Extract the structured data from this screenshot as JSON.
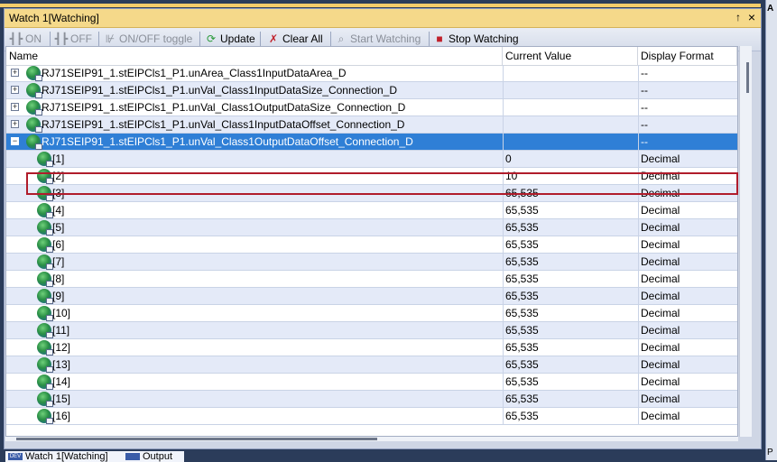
{
  "window": {
    "title": "Watch 1[Watching]",
    "pin_glyph": "↑",
    "close_glyph": "×"
  },
  "toolbar": {
    "on_label": "ON",
    "off_label": "OFF",
    "onoff_label": "ON/OFF toggle",
    "update_label": "Update",
    "clear_label": "Clear All",
    "start_label": "Start Watching",
    "stop_label": "Stop Watching"
  },
  "columns": {
    "name": "Name",
    "value": "Current Value",
    "format": "Display Format"
  },
  "rows": [
    {
      "name": "RJ71SEIP91_1.stEIPCls1_P1.unArea_Class1InputDataArea_D",
      "value": "",
      "format": "--",
      "expander": "+"
    },
    {
      "name": "RJ71SEIP91_1.stEIPCls1_P1.unVal_Class1InputDataSize_Connection_D",
      "value": "",
      "format": "--",
      "expander": "+"
    },
    {
      "name": "RJ71SEIP91_1.stEIPCls1_P1.unVal_Class1OutputDataSize_Connection_D",
      "value": "",
      "format": "--",
      "expander": "+"
    },
    {
      "name": "RJ71SEIP91_1.stEIPCls1_P1.unVal_Class1InputDataOffset_Connection_D",
      "value": "",
      "format": "--",
      "expander": "+"
    },
    {
      "name": "RJ71SEIP91_1.stEIPCls1_P1.unVal_Class1OutputDataOffset_Connection_D",
      "value": "",
      "format": "--",
      "expander": "−"
    },
    {
      "name": "[1]",
      "value": "0",
      "format": "Decimal"
    },
    {
      "name": "[2]",
      "value": "10",
      "format": "Decimal"
    },
    {
      "name": "[3]",
      "value": "65,535",
      "format": "Decimal"
    },
    {
      "name": "[4]",
      "value": "65,535",
      "format": "Decimal"
    },
    {
      "name": "[5]",
      "value": "65,535",
      "format": "Decimal"
    },
    {
      "name": "[6]",
      "value": "65,535",
      "format": "Decimal"
    },
    {
      "name": "[7]",
      "value": "65,535",
      "format": "Decimal"
    },
    {
      "name": "[8]",
      "value": "65,535",
      "format": "Decimal"
    },
    {
      "name": "[9]",
      "value": "65,535",
      "format": "Decimal"
    },
    {
      "name": "[10]",
      "value": "65,535",
      "format": "Decimal"
    },
    {
      "name": "[11]",
      "value": "65,535",
      "format": "Decimal"
    },
    {
      "name": "[12]",
      "value": "65,535",
      "format": "Decimal"
    },
    {
      "name": "[13]",
      "value": "65,535",
      "format": "Decimal"
    },
    {
      "name": "[14]",
      "value": "65,535",
      "format": "Decimal"
    },
    {
      "name": "[15]",
      "value": "65,535",
      "format": "Decimal"
    },
    {
      "name": "[16]",
      "value": "65,535",
      "format": "Decimal"
    }
  ],
  "bottom_tabs": {
    "watch_label": "Watch 1[Watching]",
    "output_label": "Output"
  },
  "right_panel": {
    "top_letter": "A",
    "bottom_letter": "P"
  }
}
